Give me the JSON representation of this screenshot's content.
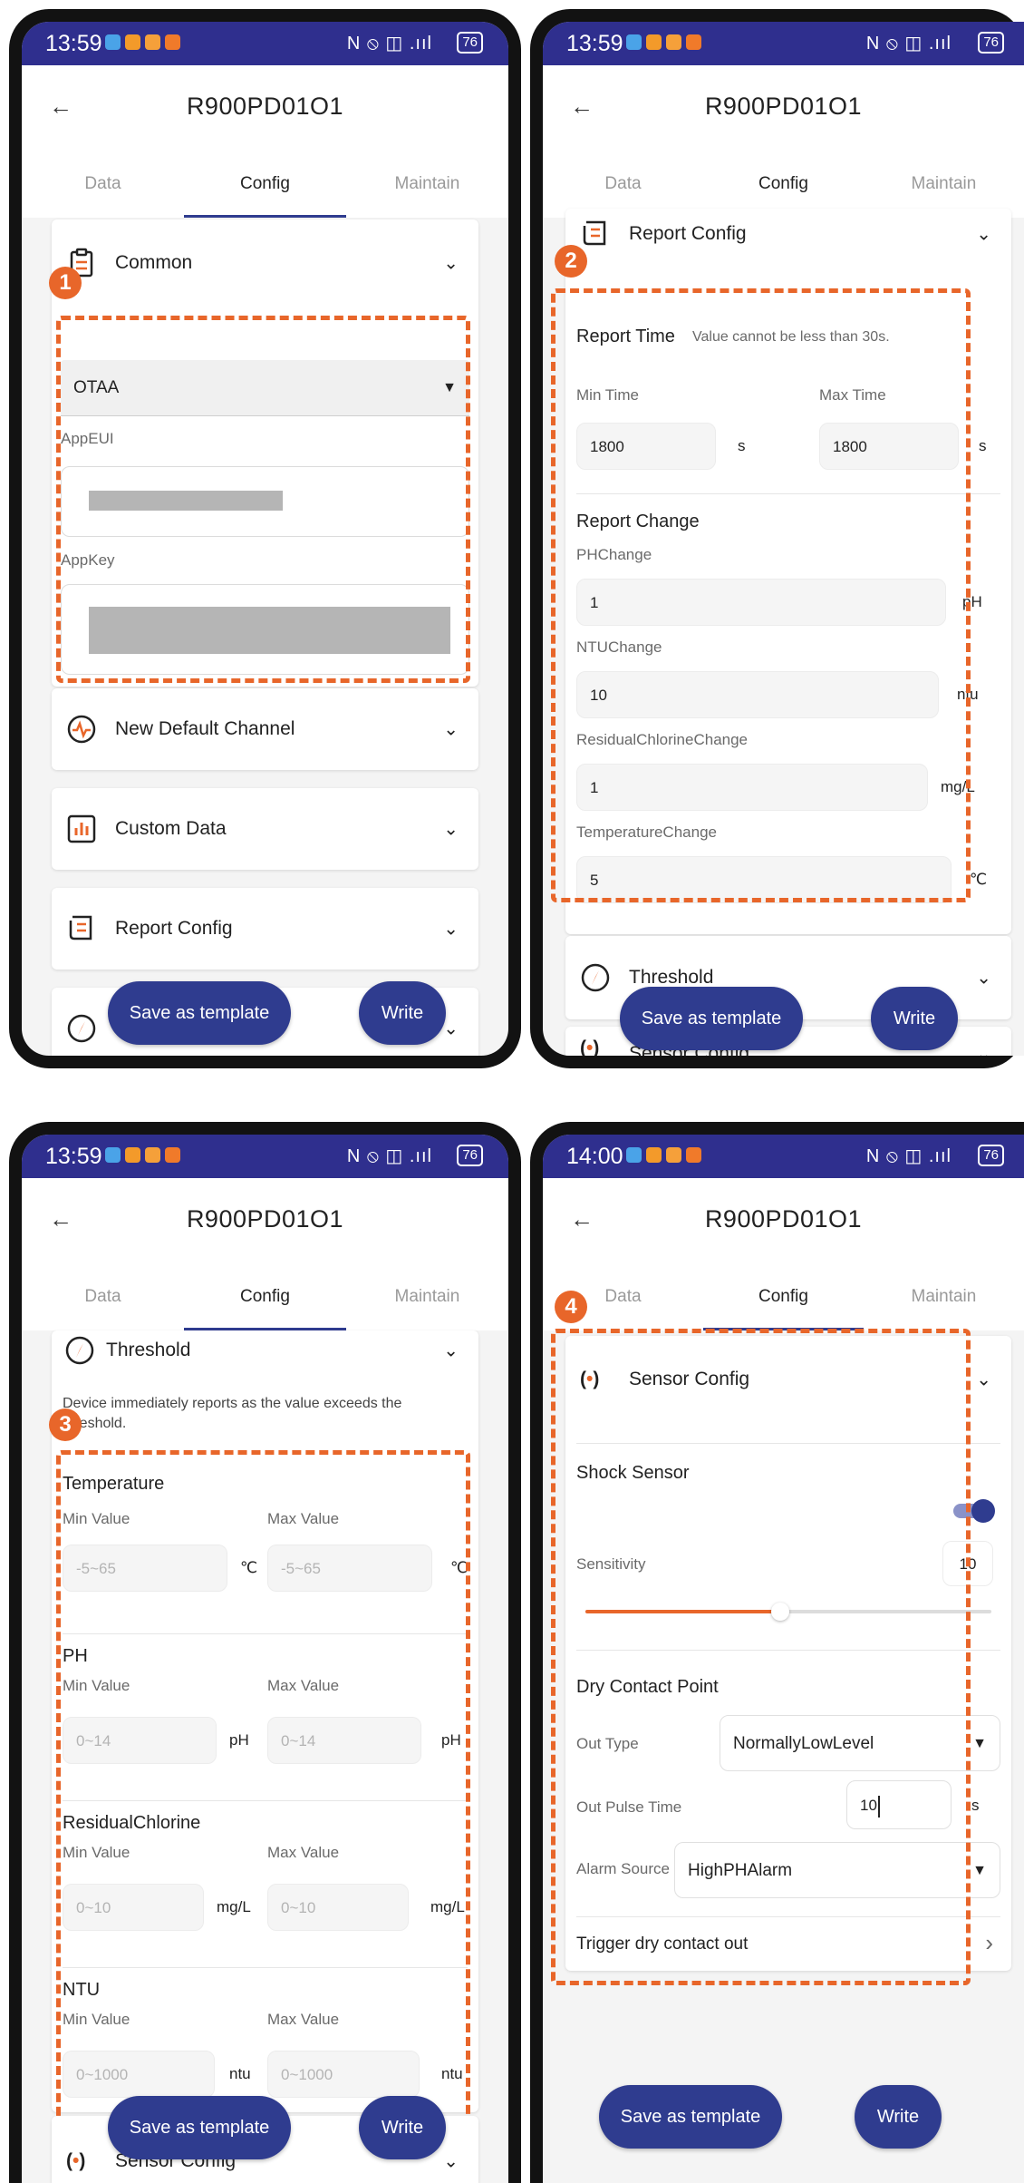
{
  "status": {
    "time_a": "13:59",
    "time_b": "14:00",
    "icons": "N ⦸ ◫ .ııl",
    "battery": "76"
  },
  "app": {
    "title": "R900PD01O1",
    "back": "←"
  },
  "tabs": {
    "data": "Data",
    "config": "Config",
    "maintain": "Maintain"
  },
  "steps": [
    "1",
    "2",
    "3",
    "4"
  ],
  "panel1": {
    "common": "Common",
    "join_mode": "OTAA",
    "app_eui_label": "AppEUI",
    "app_key_label": "AppKey",
    "new_default_channel": "New Default Channel",
    "custom_data": "Custom Data",
    "report_config": "Report Config"
  },
  "panel2": {
    "report_config": "Report Config",
    "report_time": "Report Time",
    "report_time_hint": "Value cannot be less than 30s.",
    "min_time": "Min Time",
    "max_time": "Max Time",
    "min_time_value": "1800",
    "max_time_value": "1800",
    "time_unit": "s",
    "report_change": "Report Change",
    "ph_change": "PHChange",
    "ph_value": "1",
    "ph_unit": "pH",
    "ntu_change": "NTUChange",
    "ntu_value": "10",
    "ntu_unit": "ntu",
    "rc_change": "ResidualChlorineChange",
    "rc_value": "1",
    "rc_unit": "mg/L",
    "temp_change": "TemperatureChange",
    "temp_value": "5",
    "temp_unit": "℃",
    "threshold": "Threshold",
    "sensor_config": "Sensor Config"
  },
  "panel3": {
    "threshold": "Threshold",
    "desc": "Device immediately reports as the value exceeds the threshold.",
    "min_value": "Min Value",
    "max_value": "Max Value",
    "groups": [
      {
        "name": "Temperature",
        "placeholder": "-5~65",
        "unit": "℃"
      },
      {
        "name": "PH",
        "placeholder": "0~14",
        "unit": "pH"
      },
      {
        "name": "ResidualChlorine",
        "placeholder": "0~10",
        "unit": "mg/L"
      },
      {
        "name": "NTU",
        "placeholder": "0~1000",
        "unit": "ntu"
      }
    ],
    "sensor_config": "Sensor Config"
  },
  "panel4": {
    "sensor_config": "Sensor Config",
    "shock_sensor": "Shock Sensor",
    "sensitivity": "Sensitivity",
    "sensitivity_value": "10",
    "slider_fraction": 0.48,
    "dry_contact": "Dry Contact Point",
    "out_type": "Out Type",
    "out_type_value": "NormallyLowLevel",
    "out_pulse": "Out Pulse Time",
    "out_pulse_value": "10",
    "out_pulse_unit": "s",
    "alarm_source": "Alarm Source",
    "alarm_source_value": "HighPHAlarm",
    "trigger": "Trigger dry contact out",
    "trigger_chev": "›"
  },
  "buttons": {
    "save_template": "Save as template",
    "write": "Write"
  },
  "colors": {
    "accent": "#2f3c8f",
    "highlight": "#e8662a",
    "status_bar": "#2f2f8e"
  }
}
